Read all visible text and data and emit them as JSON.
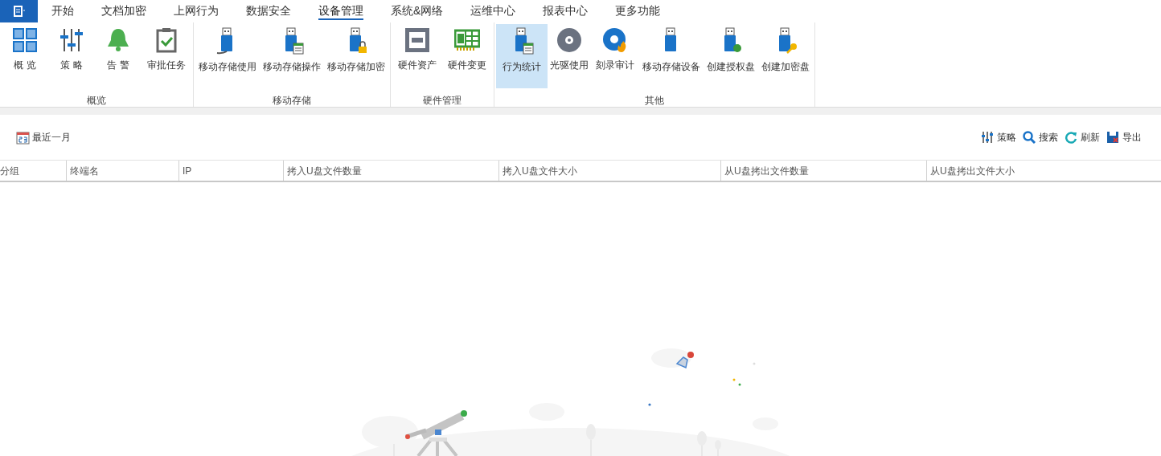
{
  "menu_tabs": [
    {
      "label": "开始",
      "selected": false
    },
    {
      "label": "文档加密",
      "selected": false
    },
    {
      "label": "上网行为",
      "selected": false
    },
    {
      "label": "数据安全",
      "selected": false
    },
    {
      "label": "设备管理",
      "selected": true
    },
    {
      "label": "系统&网络",
      "selected": false
    },
    {
      "label": "运维中心",
      "selected": false
    },
    {
      "label": "报表中心",
      "selected": false
    },
    {
      "label": "更多功能",
      "selected": false
    }
  ],
  "ribbon_groups": [
    {
      "label": "概览",
      "items": [
        {
          "label": "概 览",
          "selected": false
        },
        {
          "label": "策 略",
          "selected": false
        },
        {
          "label": "告 警",
          "selected": false
        },
        {
          "label": "审批任务",
          "selected": false
        }
      ]
    },
    {
      "label": "移动存储",
      "items": [
        {
          "label": "移动存储使用",
          "selected": false
        },
        {
          "label": "移动存储操作",
          "selected": false
        },
        {
          "label": "移动存储加密",
          "selected": false
        }
      ]
    },
    {
      "label": "硬件管理",
      "items": [
        {
          "label": "硬件资产",
          "selected": false
        },
        {
          "label": "硬件变更",
          "selected": false
        }
      ]
    },
    {
      "label": "其他",
      "items": [
        {
          "label": "行为统计",
          "selected": true
        },
        {
          "label": "光驱使用",
          "selected": false
        },
        {
          "label": "刻录审计",
          "selected": false
        },
        {
          "label": "移动存储设备",
          "selected": false
        },
        {
          "label": "创建授权盘",
          "selected": false
        },
        {
          "label": "创建加密盘",
          "selected": false
        }
      ]
    }
  ],
  "toolbar": {
    "date_range": "最近一月",
    "actions": [
      "策略",
      "搜索",
      "刷新",
      "导出"
    ]
  },
  "table": {
    "columns": [
      "分组",
      "终端名",
      "IP",
      "拷入U盘文件数量",
      "拷入U盘文件大小",
      "从U盘拷出文件数量",
      "从U盘拷出文件大小"
    ]
  }
}
